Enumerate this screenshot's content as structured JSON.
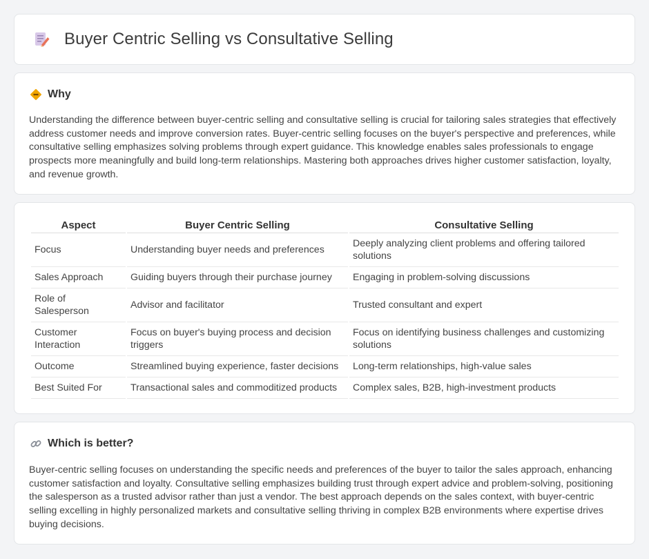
{
  "page": {
    "title": "Buyer Centric Selling vs Consultative Selling",
    "title_icon": "pencil-document-icon"
  },
  "why": {
    "icon": "diamond-sign-icon",
    "heading": "Why",
    "text": "Understanding the difference between buyer-centric selling and consultative selling is crucial for tailoring sales strategies that effectively address customer needs and improve conversion rates. Buyer-centric selling focuses on the buyer's perspective and preferences, while consultative selling emphasizes solving problems through expert guidance. This knowledge enables sales professionals to engage prospects more meaningfully and build long-term relationships. Mastering both approaches drives higher customer satisfaction, loyalty, and revenue growth."
  },
  "table": {
    "headers": [
      "Aspect",
      "Buyer Centric Selling",
      "Consultative Selling"
    ],
    "rows": [
      [
        "Focus",
        "Understanding buyer needs and preferences",
        "Deeply analyzing client problems and offering tailored solutions"
      ],
      [
        "Sales Approach",
        "Guiding buyers through their purchase journey",
        "Engaging in problem-solving discussions"
      ],
      [
        "Role of Salesperson",
        "Advisor and facilitator",
        "Trusted consultant and expert"
      ],
      [
        "Customer Interaction",
        "Focus on buyer's buying process and decision triggers",
        "Focus on identifying business challenges and customizing solutions"
      ],
      [
        "Outcome",
        "Streamlined buying experience, faster decisions",
        "Long-term relationships, high-value sales"
      ],
      [
        "Best Suited For",
        "Transactional sales and commoditized products",
        "Complex sales, B2B, high-investment products"
      ]
    ]
  },
  "better": {
    "icon": "link-icon",
    "heading": "Which is better?",
    "text": "Buyer-centric selling focuses on understanding the specific needs and preferences of the buyer to tailor the sales approach, enhancing customer satisfaction and loyalty. Consultative selling emphasizes building trust through expert advice and problem-solving, positioning the salesperson as a trusted advisor rather than just a vendor. The best approach depends on the sales context, with buyer-centric selling excelling in highly personalized markets and consultative selling thriving in complex B2B environments where expertise drives buying decisions."
  },
  "colors": {
    "background": "#f3f4f6",
    "card": "#ffffff",
    "icon_accent": "#f0a500",
    "pencil_accent": "#e8735a"
  }
}
